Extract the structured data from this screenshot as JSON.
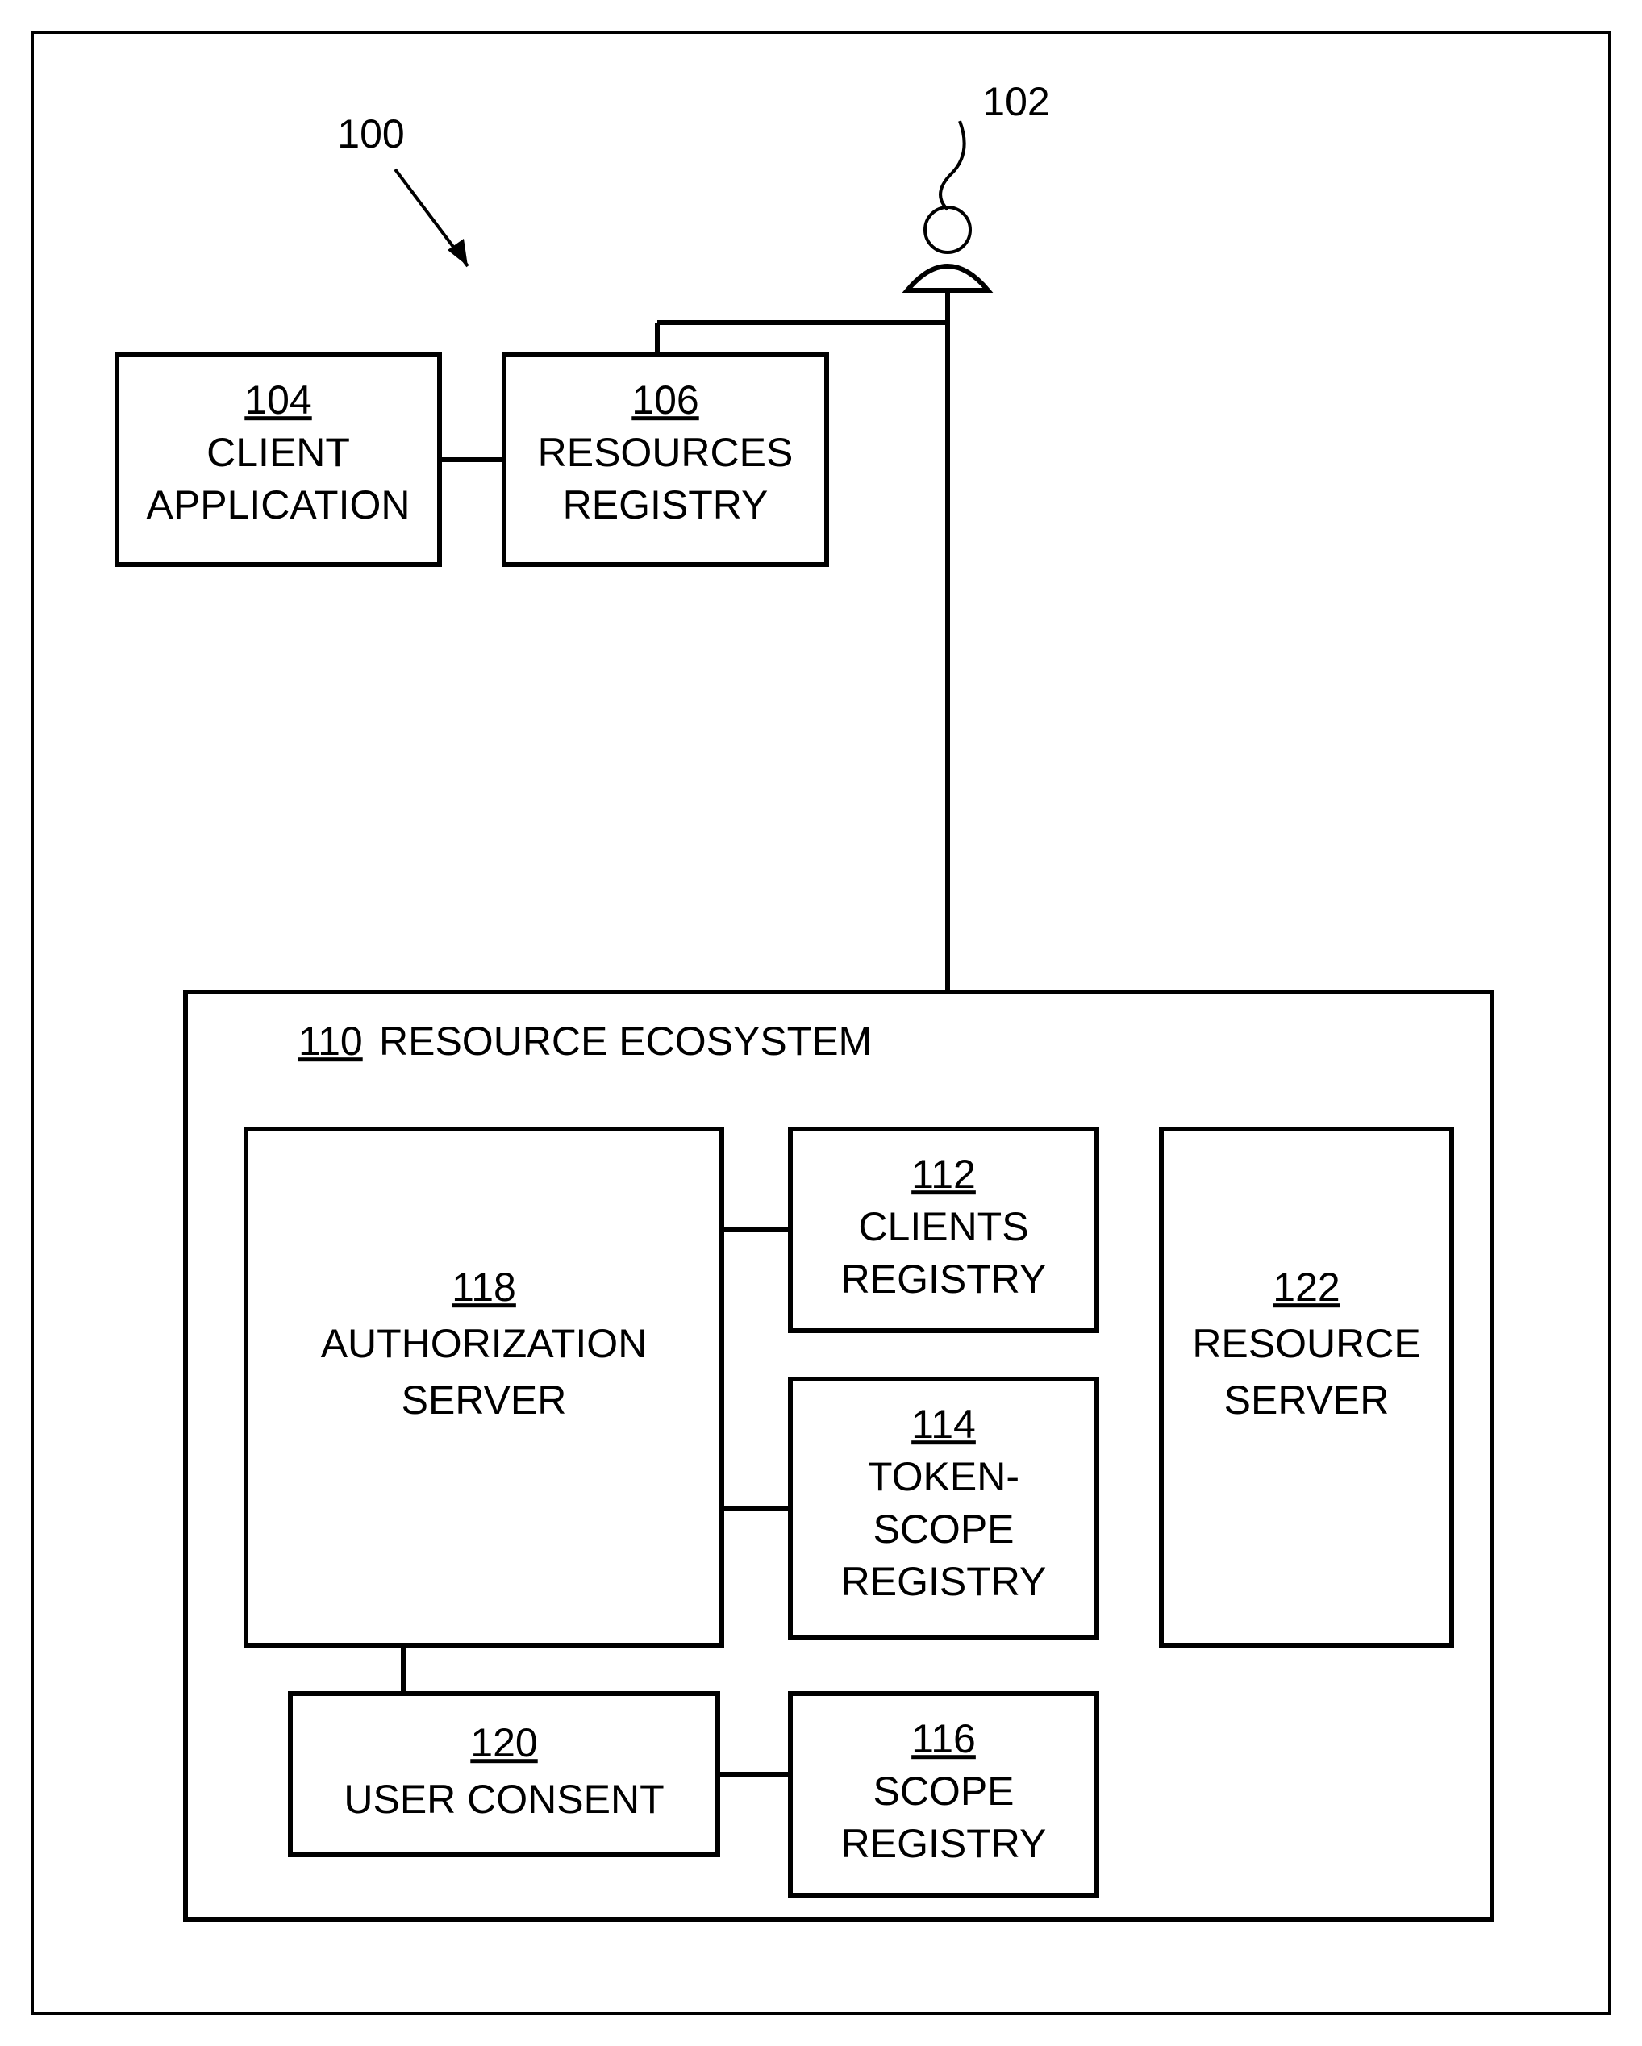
{
  "refs": {
    "system": "100",
    "user": "102"
  },
  "boxes": {
    "client_app": {
      "num": "104",
      "l1": "CLIENT",
      "l2": "APPLICATION"
    },
    "res_registry": {
      "num": "106",
      "l1": "RESOURCES",
      "l2": "REGISTRY"
    },
    "ecosystem": {
      "num": "110",
      "l1": "RESOURCE ECOSYSTEM"
    },
    "clients_reg": {
      "num": "112",
      "l1": "CLIENTS",
      "l2": "REGISTRY"
    },
    "token_scope": {
      "num": "114",
      "l1": "TOKEN-",
      "l2": "SCOPE",
      "l3": "REGISTRY"
    },
    "scope_reg": {
      "num": "116",
      "l1": "SCOPE",
      "l2": "REGISTRY"
    },
    "auth_server": {
      "num": "118",
      "l1": "AUTHORIZATION",
      "l2": "SERVER"
    },
    "user_consent": {
      "num": "120",
      "l1": "USER CONSENT"
    },
    "res_server": {
      "num": "122",
      "l1": "RESOURCE",
      "l2": "SERVER"
    }
  }
}
